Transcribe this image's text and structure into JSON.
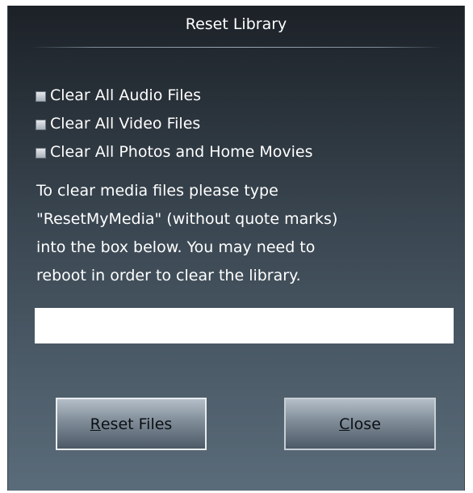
{
  "dialog": {
    "title": "Reset Library"
  },
  "options": [
    {
      "label": "Clear All Audio Files",
      "checked": false
    },
    {
      "label": "Clear All Video Files",
      "checked": false
    },
    {
      "label": "Clear All Photos and Home Movies",
      "checked": false
    }
  ],
  "instructions": {
    "lines": [
      "To clear media files please type",
      "\"ResetMyMedia\" (without quote marks)",
      "into the box below. You may need to",
      "reboot in order to clear the library."
    ]
  },
  "input": {
    "value": "",
    "placeholder": ""
  },
  "buttons": {
    "reset": {
      "mnemonic": "R",
      "rest": "eset Files"
    },
    "close": {
      "mnemonic": "C",
      "rest": "lose"
    }
  },
  "colors": {
    "background_top": "#1c2127",
    "background_bottom": "#5a6b79",
    "text": "#ffffff",
    "button_text": "#0b0f13"
  },
  "icons": {
    "checkbox": "checkbox-unchecked-icon"
  }
}
